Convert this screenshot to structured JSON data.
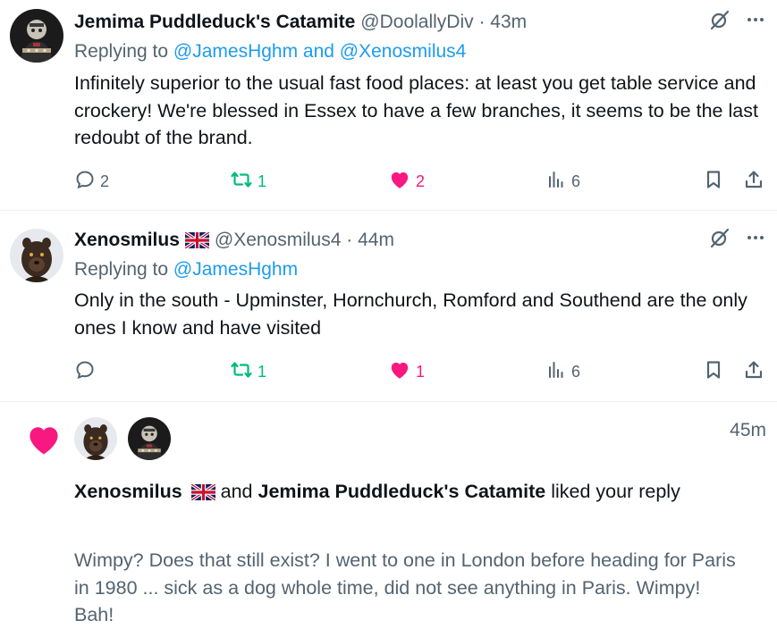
{
  "tweets": [
    {
      "name": "Jemima Puddleduck's Catamite",
      "handle": "@DoolallyDiv · 43m",
      "reply_prefix": "Replying to ",
      "reply_mentions": "@JamesHghm and @Xenosmilus4",
      "text": "Infinitely superior to the usual fast food places: at least you get table service and crockery! We're blessed in Essex to have a few branches, it seems to be the last redoubt of the brand.",
      "replies": "2",
      "retweets": "1",
      "likes": "2",
      "views": "6"
    },
    {
      "name": "Xenosmilus",
      "handle": "@Xenosmilus4 · 44m",
      "reply_prefix": "Replying to ",
      "reply_mentions": "@JamesHghm",
      "text": "Only in the south - Upminster, Hornchurch, Romford and Southend are the only ones I know and have visited",
      "replies": "",
      "retweets": "1",
      "likes": "1",
      "views": "6"
    }
  ],
  "notification": {
    "time": "45m",
    "user1": "Xenosmilus",
    "connector": " and ",
    "user2": "Jemima Puddleduck's Catamite",
    "action": " liked your reply",
    "quoted": "Wimpy?  Does that still exist?  I went to one in London before heading for Paris in 1980 ... sick as a dog whole time, did not see anything in Paris. Wimpy! Bah!"
  },
  "icons": {
    "grok": "grok-icon",
    "more": "more-icon",
    "reply": "reply-icon",
    "retweet": "retweet-icon",
    "like": "heart-icon",
    "views": "views-icon",
    "bookmark": "bookmark-icon",
    "share": "share-icon",
    "flag": "uk-flag-icon"
  },
  "colors": {
    "link": "#1d9bf0",
    "retweet": "#00ba7c",
    "like": "#f91880",
    "muted": "#536471",
    "text": "#0f1419"
  }
}
